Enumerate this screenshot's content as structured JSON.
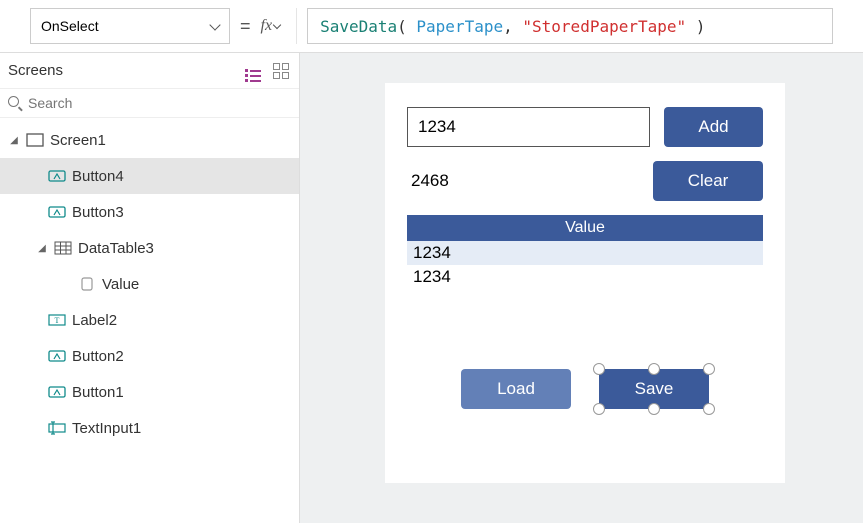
{
  "property_dropdown": {
    "value": "OnSelect"
  },
  "formula": {
    "func": "SaveData",
    "open": "(",
    "arg1": "PaperTape",
    "comma": ",",
    "arg2": "\"StoredPaperTape\"",
    "close": ")"
  },
  "panel": {
    "title": "Screens",
    "search_placeholder": "Search"
  },
  "tree": {
    "screen1": "Screen1",
    "button4": "Button4",
    "button3": "Button3",
    "datatable3": "DataTable3",
    "value": "Value",
    "label2": "Label2",
    "button2": "Button2",
    "button1": "Button1",
    "textinput1": "TextInput1"
  },
  "canvas": {
    "input_value": "1234",
    "calc_value": "2468",
    "add_btn": "Add",
    "clear_btn": "Clear",
    "table_header": "Value",
    "rows": {
      "r0": "1234",
      "r1": "1234"
    },
    "load_btn": "Load",
    "save_btn": "Save"
  }
}
